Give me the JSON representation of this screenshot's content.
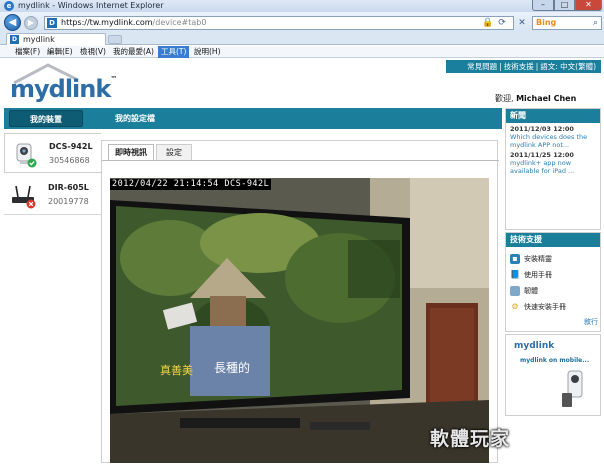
{
  "window": {
    "title": "mydlink - Windows Internet Explorer",
    "url_host": "https://tw.mydlink.com",
    "url_path": "/device#tab0",
    "search_engine": "Bing",
    "tab_label": "mydlink"
  },
  "menu": [
    "檔案(F)",
    "編輯(E)",
    "檢視(V)",
    "我的最愛(A)",
    "工具(T)",
    "說明(H)"
  ],
  "menu_active_index": 4,
  "site": {
    "logo": "mydlink",
    "top_links": [
      "常見問題",
      "技術支援",
      "語文: 中文(繁體)"
    ],
    "welcome_prefix": "歡迎, ",
    "welcome_user": "Michael Chen",
    "nav": {
      "my_devices": "我的裝置",
      "my_settings": "我的設定檔"
    }
  },
  "devices": [
    {
      "name": "DCS-942L",
      "id": "30546868",
      "status": "online",
      "selected": true
    },
    {
      "name": "DIR-605L",
      "id": "20019778",
      "status": "offline",
      "selected": false
    }
  ],
  "panel": {
    "tab_live": "即時視訊",
    "tab_settings": "設定",
    "video_osd": "2012/04/22 21:14:54 DCS-942L",
    "tv_caption": "長種的",
    "tv_logo": "真善美"
  },
  "news": {
    "title": "新聞",
    "items": [
      {
        "date": "2011/12/03 12:00",
        "text": "Which devices does the mydlink APP not..."
      },
      {
        "date": "2011/11/25 12:00",
        "text": "mydlink+ app now available for iPad ..."
      }
    ]
  },
  "support": {
    "title": "技術支援",
    "items": [
      "安裝精靈",
      "使用手冊",
      "韌體",
      "快速安裝手冊"
    ],
    "more": "敘行"
  },
  "promo": {
    "logo": "mydlink",
    "text": "mydlink on mobile..."
  },
  "watermark": "軟體玩家",
  "colors": {
    "teal": "#1b7f9b",
    "brand_blue": "#2e6ea6",
    "online": "#2da84a",
    "offline": "#d23a2e"
  }
}
